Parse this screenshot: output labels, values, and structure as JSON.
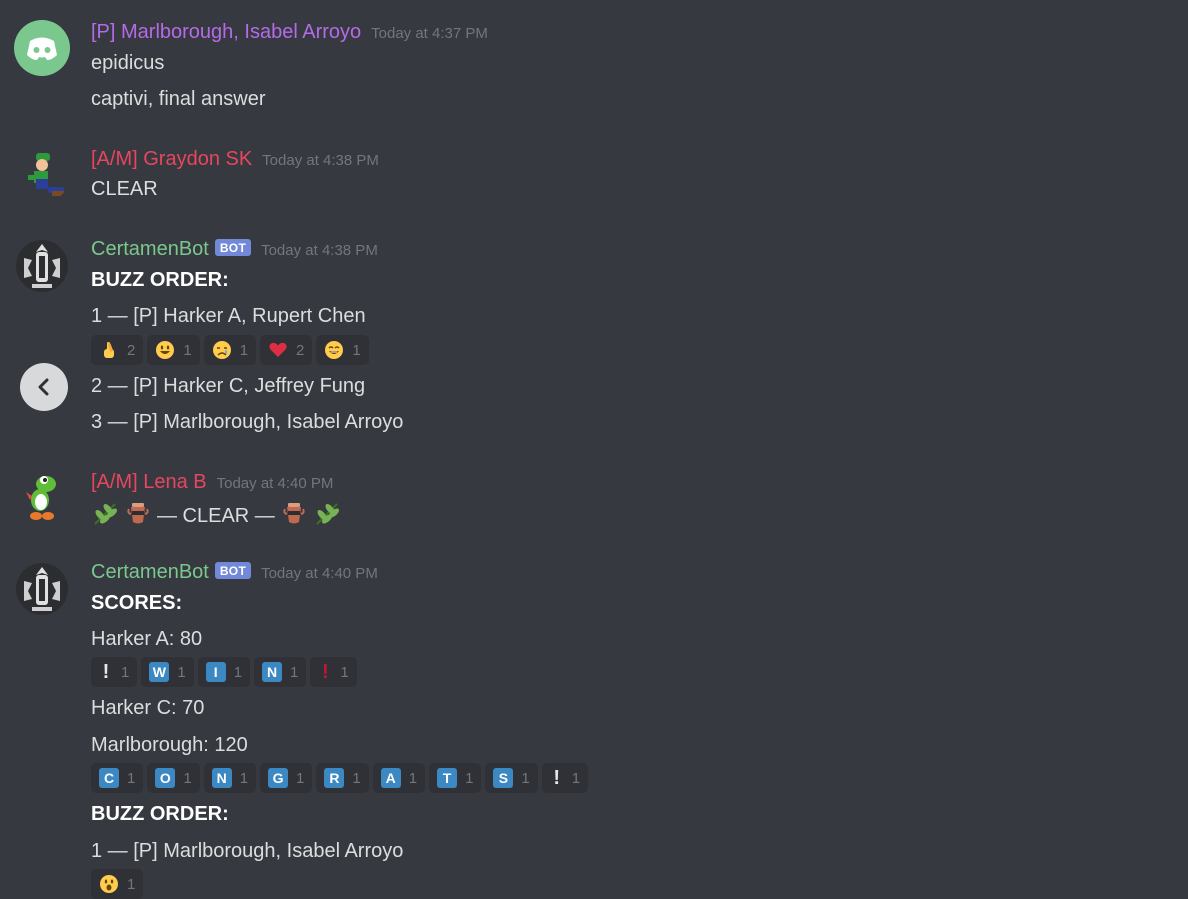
{
  "colors": {
    "background": "#36393f",
    "purple": "#b66ae8",
    "red": "#e8465e",
    "green": "#7bc88f",
    "bot_badge": "#7289da"
  },
  "messages": [
    {
      "author": "[P] Marlborough, Isabel Arroyo",
      "time": "Today at 4:37 PM",
      "lines": [
        "epidicus",
        "captivi, final answer"
      ]
    },
    {
      "author": "[A/M] Graydon SK",
      "time": "Today at 4:38 PM",
      "lines": [
        "CLEAR"
      ]
    },
    {
      "author": "CertamenBot",
      "badge": "BOT",
      "time": "Today at 4:38 PM",
      "heading": "BUZZ ORDER:",
      "lines": [
        "1 — [P] Harker A, Rupert Chen",
        "2 — [P] Harker C, Jeffrey Fung",
        "3 — [P] Marlborough, Isabel Arroyo"
      ],
      "reactions": [
        {
          "icon": "crossed-fingers",
          "count": "2"
        },
        {
          "icon": "smiley",
          "count": "1"
        },
        {
          "icon": "cry",
          "count": "1"
        },
        {
          "icon": "heart",
          "count": "2"
        },
        {
          "icon": "smile",
          "count": "1"
        }
      ]
    },
    {
      "author": "[A/M] Lena B",
      "time": "Today at 4:40 PM",
      "lines": [
        "— CLEAR —"
      ]
    },
    {
      "author": "CertamenBot",
      "badge": "BOT",
      "time": "Today at 4:40 PM",
      "heading": "SCORES:",
      "lines": [
        "Harker A: 80",
        "Harker C: 70",
        "Marlborough: 120"
      ],
      "reactions_a": [
        {
          "glyph": "!",
          "count": "1"
        },
        {
          "glyph": "W",
          "count": "1"
        },
        {
          "glyph": "I",
          "count": "1"
        },
        {
          "glyph": "N",
          "count": "1"
        },
        {
          "glyph": "!",
          "count": "1"
        }
      ],
      "reactions_b": [
        {
          "glyph": "C",
          "count": "1"
        },
        {
          "glyph": "O",
          "count": "1"
        },
        {
          "glyph": "N",
          "count": "1"
        },
        {
          "glyph": "G",
          "count": "1"
        },
        {
          "glyph": "R",
          "count": "1"
        },
        {
          "glyph": "A",
          "count": "1"
        },
        {
          "glyph": "T",
          "count": "1"
        },
        {
          "glyph": "S",
          "count": "1"
        },
        {
          "glyph": "!",
          "count": "1"
        }
      ],
      "heading2": "BUZZ ORDER:",
      "lines2": [
        "1 — [P] Marlborough, Isabel Arroyo"
      ],
      "reactions_c": [
        {
          "icon": "open-mouth",
          "count": "1"
        }
      ]
    }
  ]
}
